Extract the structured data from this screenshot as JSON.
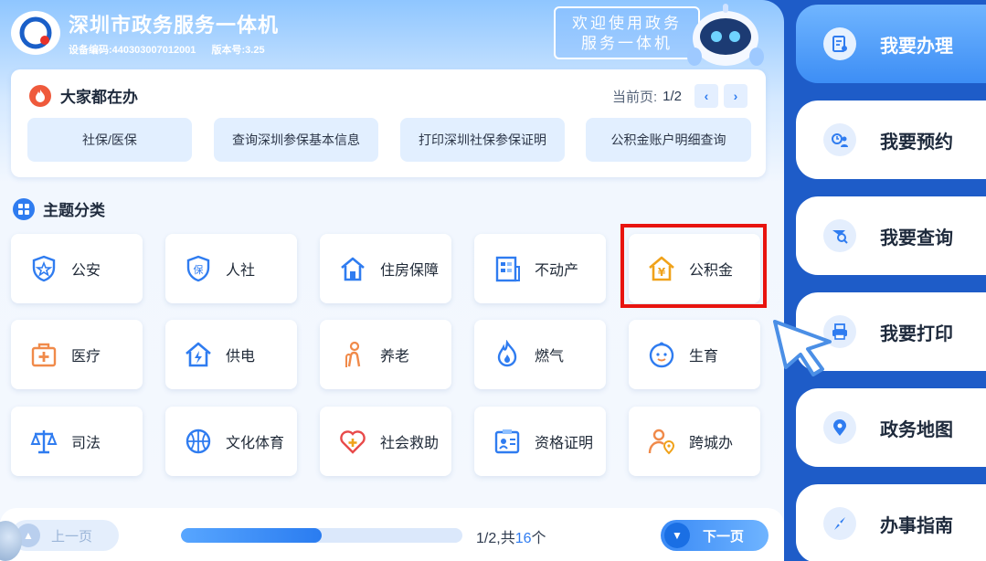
{
  "header": {
    "title": "深圳市政务服务一体机",
    "device_code": "设备编码:440303007012001",
    "version": "版本号:3.25",
    "welcome_line1": "欢迎使用政务",
    "welcome_line2": "服务一体机"
  },
  "popular": {
    "title": "大家都在办",
    "pager_label": "当前页:",
    "pager_value": "1/2",
    "buttons": [
      "社保/医保",
      "查询深圳参保基本信息",
      "打印深圳社保参保证明",
      "公积金账户明细查询"
    ]
  },
  "topics": {
    "title": "主题分类",
    "tiles": [
      {
        "label": "公安",
        "icon": "police-shield-icon"
      },
      {
        "label": "人社",
        "icon": "social-security-shield-icon"
      },
      {
        "label": "住房保障",
        "icon": "house-icon"
      },
      {
        "label": "不动产",
        "icon": "building-doc-icon"
      },
      {
        "label": "公积金",
        "icon": "housing-fund-yen-house-icon"
      },
      {
        "label": "医疗",
        "icon": "medical-kit-icon"
      },
      {
        "label": "供电",
        "icon": "power-house-icon"
      },
      {
        "label": "养老",
        "icon": "elderly-person-icon"
      },
      {
        "label": "燃气",
        "icon": "gas-flame-icon"
      },
      {
        "label": "生育",
        "icon": "baby-face-icon"
      },
      {
        "label": "司法",
        "icon": "justice-scale-icon"
      },
      {
        "label": "文化体育",
        "icon": "sports-ball-icon"
      },
      {
        "label": "社会救助",
        "icon": "heart-aid-icon"
      },
      {
        "label": "资格证明",
        "icon": "certificate-icon"
      },
      {
        "label": "跨城办",
        "icon": "person-location-icon"
      }
    ]
  },
  "footer": {
    "prev_label": "上一页",
    "next_label": "下一页",
    "page_current": "1/2,共",
    "page_total": "16",
    "page_unit": "个",
    "progress": 0.5
  },
  "nav": [
    {
      "label": "我要办理",
      "icon": "document-edit-icon",
      "active": true
    },
    {
      "label": "我要预约",
      "icon": "appointment-user-icon",
      "active": false
    },
    {
      "label": "我要查询",
      "icon": "search-query-icon",
      "active": false
    },
    {
      "label": "我要打印",
      "icon": "printer-icon",
      "active": false
    },
    {
      "label": "政务地图",
      "icon": "map-pin-icon",
      "active": false
    },
    {
      "label": "办事指南",
      "icon": "compass-icon",
      "active": false
    }
  ],
  "colors": {
    "accent": "#2f7cf0",
    "highlight_border": "#e8140f",
    "nav_background": "#1e5cc8"
  }
}
